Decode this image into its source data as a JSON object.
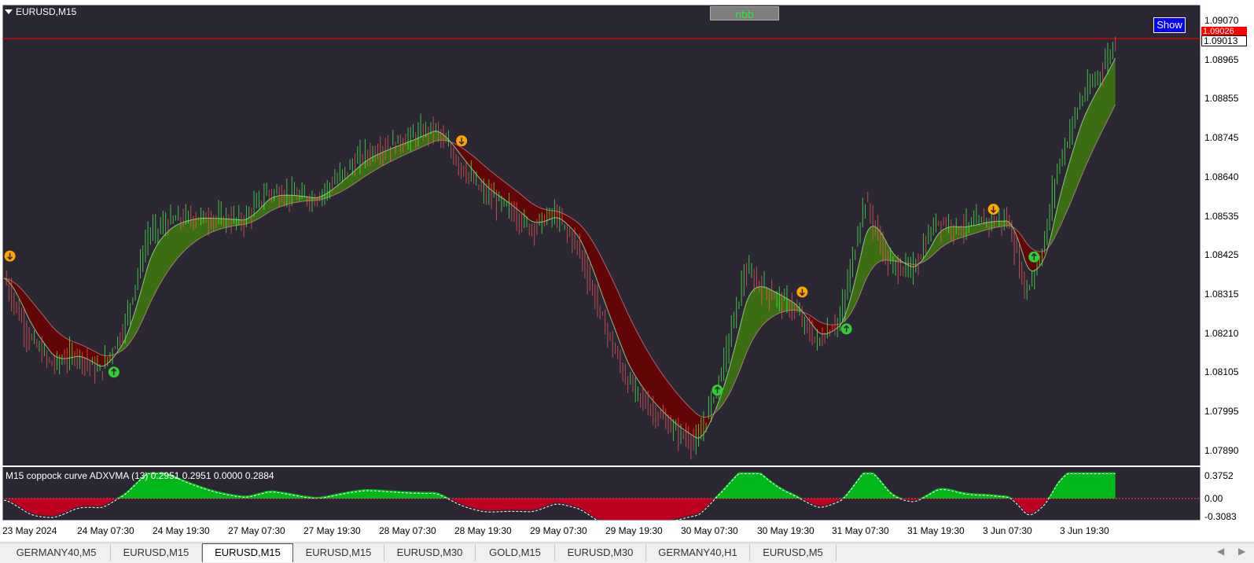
{
  "chart": {
    "symbol_label": "EURUSD,M15",
    "ribb_label": "ribb",
    "show_label": "Show",
    "indicator_label": "M15 coppock curve ADXVMA (13) 0.2951 0.2951 0.0000 0.2884",
    "bid_price": "1.09026",
    "ask_price": "1.09013",
    "price_axis": [
      "1.09070",
      "1.08965",
      "1.08855",
      "1.08745",
      "1.08640",
      "1.08535",
      "1.08425",
      "1.08315",
      "1.08210",
      "1.08105",
      "1.07995",
      "1.07890"
    ],
    "oscillator_axis": [
      "0.3752",
      "0.00",
      "-0.3083"
    ],
    "time_axis": [
      "23 May 2024",
      "24 May 07:30",
      "24 May 19:30",
      "27 May 07:30",
      "27 May 19:30",
      "28 May 07:30",
      "28 May 19:30",
      "29 May 07:30",
      "29 May 19:30",
      "30 May 07:30",
      "30 May 19:30",
      "31 May 07:30",
      "31 May 19:30",
      "3 Jun 07:30",
      "3 Jun 19:30"
    ],
    "colors": {
      "background": "#2a2733",
      "bull_band": "#3e7a0e",
      "bull_band_dark": "#1f3d12",
      "bear_band": "#6b0000",
      "bear_band_dark": "#3a0000",
      "bull_line": "#4cff4c",
      "bear_line": "#ff5a5a",
      "osc_up": "#00b81a",
      "osc_down": "#c00020",
      "arrow_up": "#32cd32",
      "arrow_down": "#ffa500",
      "price_line": "#ff0000"
    }
  },
  "tabs": [
    {
      "label": "GERMANY40,M5",
      "active": false
    },
    {
      "label": "EURUSD,M15",
      "active": false
    },
    {
      "label": "EURUSD,M15",
      "active": true
    },
    {
      "label": "EURUSD,M15",
      "active": false
    },
    {
      "label": "EURUSD,M30",
      "active": false
    },
    {
      "label": "GOLD,M15",
      "active": false
    },
    {
      "label": "EURUSD,M30",
      "active": false
    },
    {
      "label": "GERMANY40,H1",
      "active": false
    },
    {
      "label": "EURUSD,M5",
      "active": false
    }
  ],
  "chart_data": {
    "type": "candlestick",
    "price_range": [
      1.0784,
      1.0912
    ],
    "current_price_line": 1.09026,
    "price_path": [
      [
        0,
        1.0836
      ],
      [
        0.02,
        1.082
      ],
      [
        0.04,
        1.0812
      ],
      [
        0.06,
        1.0815
      ],
      [
        0.08,
        1.081
      ],
      [
        0.1,
        1.0822
      ],
      [
        0.12,
        1.0848
      ],
      [
        0.14,
        1.0852
      ],
      [
        0.16,
        1.0853
      ],
      [
        0.2,
        1.0852
      ],
      [
        0.22,
        1.086
      ],
      [
        0.26,
        1.0858
      ],
      [
        0.3,
        1.087
      ],
      [
        0.34,
        1.0875
      ],
      [
        0.36,
        1.0878
      ],
      [
        0.38,
        1.0868
      ],
      [
        0.4,
        1.086
      ],
      [
        0.42,
        1.0856
      ],
      [
        0.44,
        1.085
      ],
      [
        0.46,
        1.0854
      ],
      [
        0.48,
        1.0845
      ],
      [
        0.5,
        1.0825
      ],
      [
        0.52,
        1.0808
      ],
      [
        0.54,
        1.08
      ],
      [
        0.56,
        1.0794
      ],
      [
        0.58,
        1.079
      ],
      [
        0.6,
        1.081
      ],
      [
        0.62,
        1.0838
      ],
      [
        0.64,
        1.0832
      ],
      [
        0.66,
        1.0828
      ],
      [
        0.68,
        1.0818
      ],
      [
        0.7,
        1.0825
      ],
      [
        0.72,
        1.0858
      ],
      [
        0.74,
        1.084
      ],
      [
        0.76,
        1.0838
      ],
      [
        0.78,
        1.0852
      ],
      [
        0.8,
        1.085
      ],
      [
        0.82,
        1.0852
      ],
      [
        0.84,
        1.0852
      ],
      [
        0.855,
        1.0832
      ],
      [
        0.87,
        1.0845
      ],
      [
        0.88,
        1.0865
      ],
      [
        0.9,
        1.0885
      ],
      [
        0.92,
        1.0895
      ],
      [
        0.93,
        1.0902
      ]
    ]
  }
}
